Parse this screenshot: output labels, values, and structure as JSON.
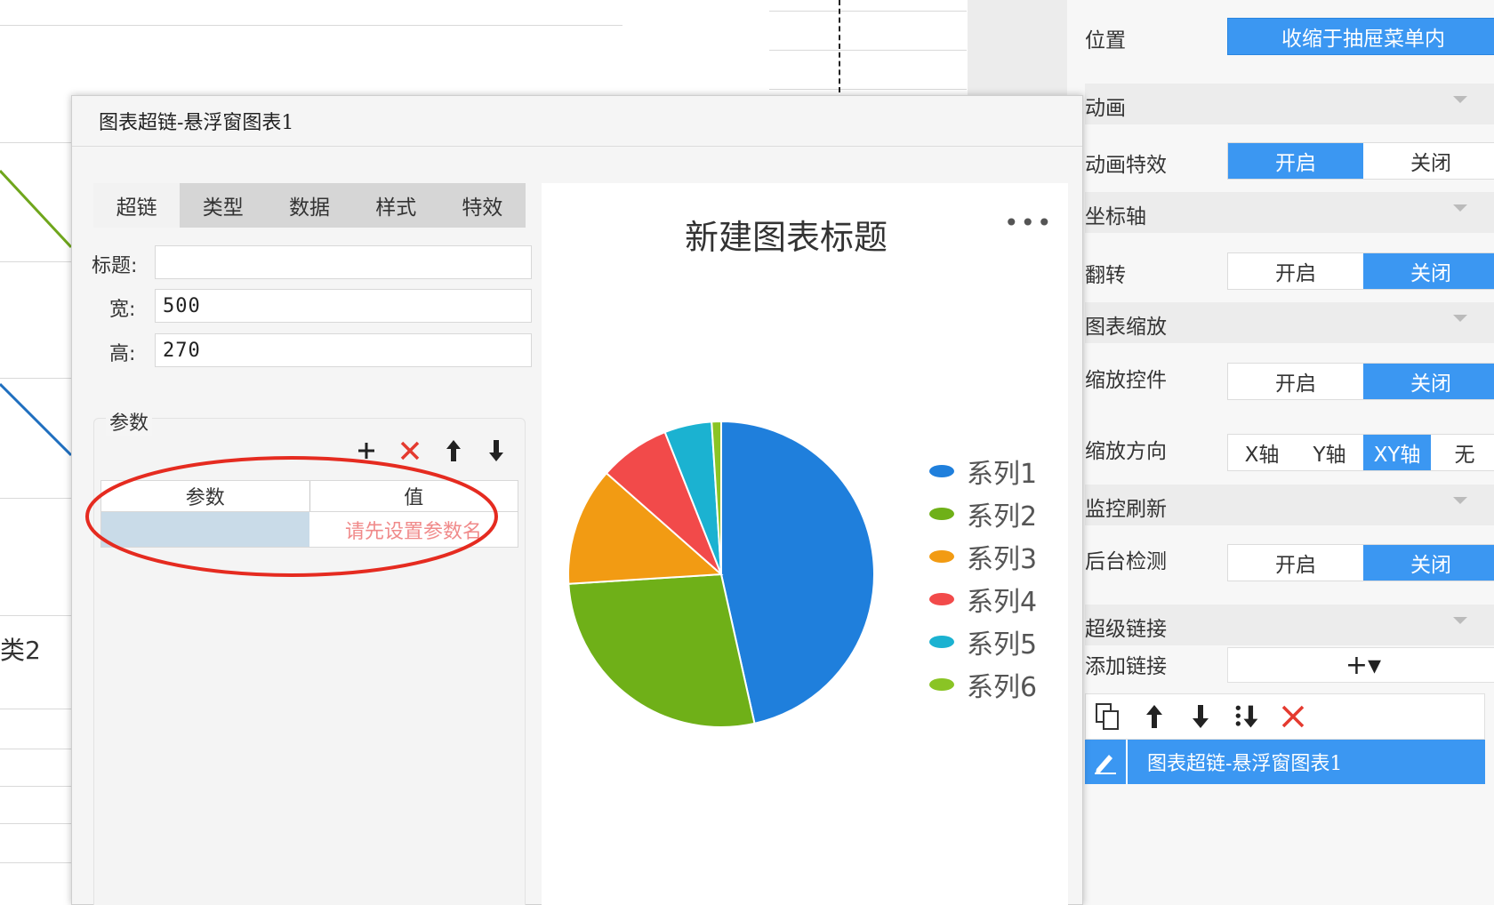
{
  "background": {
    "partial_label": "类2"
  },
  "props": {
    "position_label": "位置",
    "position_value": "收缩于抽屉菜单内",
    "sections": {
      "animation": "动画",
      "axis": "坐标轴",
      "chart_zoom": "图表缩放",
      "monitor_refresh": "监控刷新",
      "hyperlink": "超级链接"
    },
    "animation_effect": {
      "label": "动画特效",
      "on": "开启",
      "off": "关闭",
      "selected": "on"
    },
    "flip": {
      "label": "翻转",
      "on": "开启",
      "off": "关闭",
      "selected": "off"
    },
    "zoom_control": {
      "label": "缩放控件",
      "on": "开启",
      "off": "关闭",
      "selected": "off"
    },
    "zoom_direction": {
      "label": "缩放方向",
      "options": [
        "X轴",
        "Y轴",
        "XY轴",
        "无"
      ],
      "selected": "XY轴"
    },
    "background_check": {
      "label": "后台检测",
      "on": "开启",
      "off": "关闭",
      "selected": "off"
    },
    "add_link": {
      "label": "添加链接",
      "value": "+▾"
    },
    "link_item": "图表超链-悬浮窗图表1",
    "accent_color": "#3b97f2"
  },
  "dialog": {
    "title": "图表超链-悬浮窗图表1",
    "tabs": [
      "超链",
      "类型",
      "数据",
      "样式",
      "特效"
    ],
    "active_tab": "超链",
    "title_label": "标题:",
    "title_value": "",
    "width_label": "宽:",
    "width_value": "500",
    "height_label": "高:",
    "height_value": "270",
    "params_legend": "参数",
    "table_headers": [
      "参数",
      "值"
    ],
    "value_placeholder": "请先设置参数名"
  },
  "chart_data": {
    "type": "pie",
    "title": "新建图表标题",
    "series": [
      {
        "name": "系列1",
        "value": 46.5,
        "color": "#1f7fdc"
      },
      {
        "name": "系列2",
        "value": 27.5,
        "color": "#6fb018"
      },
      {
        "name": "系列3",
        "value": 12.5,
        "color": "#f29b13"
      },
      {
        "name": "系列4",
        "value": 7.5,
        "color": "#f24a4a"
      },
      {
        "name": "系列5",
        "value": 5.0,
        "color": "#1bb2d1"
      },
      {
        "name": "系列6",
        "value": 1.0,
        "color": "#8ac425"
      }
    ],
    "legend_position": "right"
  }
}
